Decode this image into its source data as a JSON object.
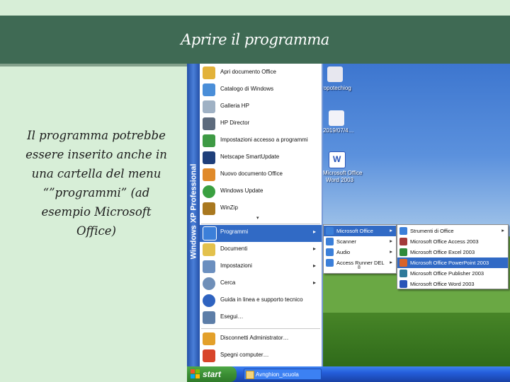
{
  "slide": {
    "title": "Aprire il programma",
    "body_lines": [
      "Il programma potrebbe",
      "essere inserito anche in",
      "una cartella del menu",
      "“”programmi” (ad",
      "esempio Microsoft",
      "Office)"
    ]
  },
  "desktop": {
    "icons": [
      {
        "label": "ropotechiog",
        "icon": "folder-icon",
        "color": "#e7e7ef"
      },
      {
        "label": "2019/07/4…",
        "icon": "document-icon",
        "color": "#f2f2f8"
      },
      {
        "label": "Microsoft Office",
        "icon": "word-icon",
        "color": "#ffffff"
      },
      {
        "label": "Word 2003",
        "icon": "",
        "color": ""
      }
    ]
  },
  "start_menu": {
    "side_label": "Windows XP Professional",
    "pinned": [
      {
        "label": "Apri documento Office",
        "icon": "open-office-doc-icon",
        "color": "#e2b23a"
      },
      {
        "label": "Catalogo di Windows",
        "icon": "windows-catalog-icon",
        "color": "#4a8ed8"
      },
      {
        "label": "Galleria HP",
        "icon": "hp-gallery-icon",
        "color": "#9fb1c4"
      },
      {
        "label": "HP Director",
        "icon": "hp-director-icon",
        "color": "#5d6b7d"
      },
      {
        "label": "Impostazioni accesso a programmi",
        "icon": "program-access-icon",
        "color": "#3e9a44"
      },
      {
        "label": "Netscape SmartUpdate",
        "icon": "netscape-icon",
        "color": "#1f3f7a"
      },
      {
        "label": "Nuovo documento Office",
        "icon": "new-office-doc-icon",
        "color": "#e08a2a"
      },
      {
        "label": "Windows Update",
        "icon": "windows-update-icon",
        "color": "#3aa040"
      },
      {
        "label": "WinZip",
        "icon": "winzip-icon",
        "color": "#a9781f"
      }
    ],
    "more_symbol": "▾",
    "items": [
      {
        "label": "Programmi",
        "icon": "programs-icon",
        "color": "#3b7fd9",
        "has_submenu": true,
        "active": true
      },
      {
        "label": "Documenti",
        "icon": "documents-icon",
        "color": "#e3c14c",
        "has_submenu": true,
        "active": false
      },
      {
        "label": "Impostazioni",
        "icon": "settings-icon",
        "color": "#6b8fbf",
        "has_submenu": true,
        "active": false
      },
      {
        "label": "Cerca",
        "icon": "search-icon",
        "color": "#6f8fb8",
        "has_submenu": true,
        "active": false
      },
      {
        "label": "Guida in linea e supporto tecnico",
        "icon": "help-icon",
        "color": "#2f63c0",
        "has_submenu": false,
        "active": false
      },
      {
        "label": "Esegui…",
        "icon": "run-icon",
        "color": "#5d7ea8",
        "has_submenu": false,
        "active": false
      }
    ],
    "footer": [
      {
        "label": "Disconnetti Administrator…",
        "icon": "logoff-icon",
        "color": "#e3a02a"
      },
      {
        "label": "Spegni computer…",
        "icon": "shutdown-icon",
        "color": "#d8452a"
      }
    ],
    "submenu_arrow": "▸"
  },
  "programs_submenu": [
    {
      "label": "Microsoft Office",
      "icon": "folder-icon",
      "color": "#3b7fd9",
      "has_submenu": true,
      "active": true
    },
    {
      "label": "Scanner",
      "icon": "folder-icon",
      "color": "#3b7fd9",
      "has_submenu": true,
      "active": false
    },
    {
      "label": "Audio",
      "icon": "folder-icon",
      "color": "#3b7fd9",
      "has_submenu": true,
      "active": false
    },
    {
      "label": "Access Runner DEL",
      "icon": "folder-icon",
      "color": "#3b7fd9",
      "has_submenu": true,
      "active": false
    }
  ],
  "programs_more_symbol": "8",
  "office_submenu": [
    {
      "label": "Strumenti di Office",
      "icon": "office-tools-icon",
      "color": "#3b7fd9",
      "has_submenu": true,
      "active": false
    },
    {
      "label": "Microsoft Office Access 2003",
      "icon": "access-icon",
      "color": "#a33a3a",
      "has_submenu": false,
      "active": false
    },
    {
      "label": "Microsoft Office Excel 2003",
      "icon": "excel-icon",
      "color": "#2f8a3a",
      "has_submenu": false,
      "active": false
    },
    {
      "label": "Microsoft Office PowerPoint 2003",
      "icon": "powerpoint-icon",
      "color": "#d8632a",
      "has_submenu": false,
      "active": true
    },
    {
      "label": "Microsoft Office Publisher 2003",
      "icon": "publisher-icon",
      "color": "#2f7a9a",
      "has_submenu": false,
      "active": false
    },
    {
      "label": "Microsoft Office Word 2003",
      "icon": "word-icon",
      "color": "#2a55b8",
      "has_submenu": false,
      "active": false
    }
  ],
  "taskbar": {
    "start_label": "start",
    "task_label": "Avnghion_scuola"
  }
}
